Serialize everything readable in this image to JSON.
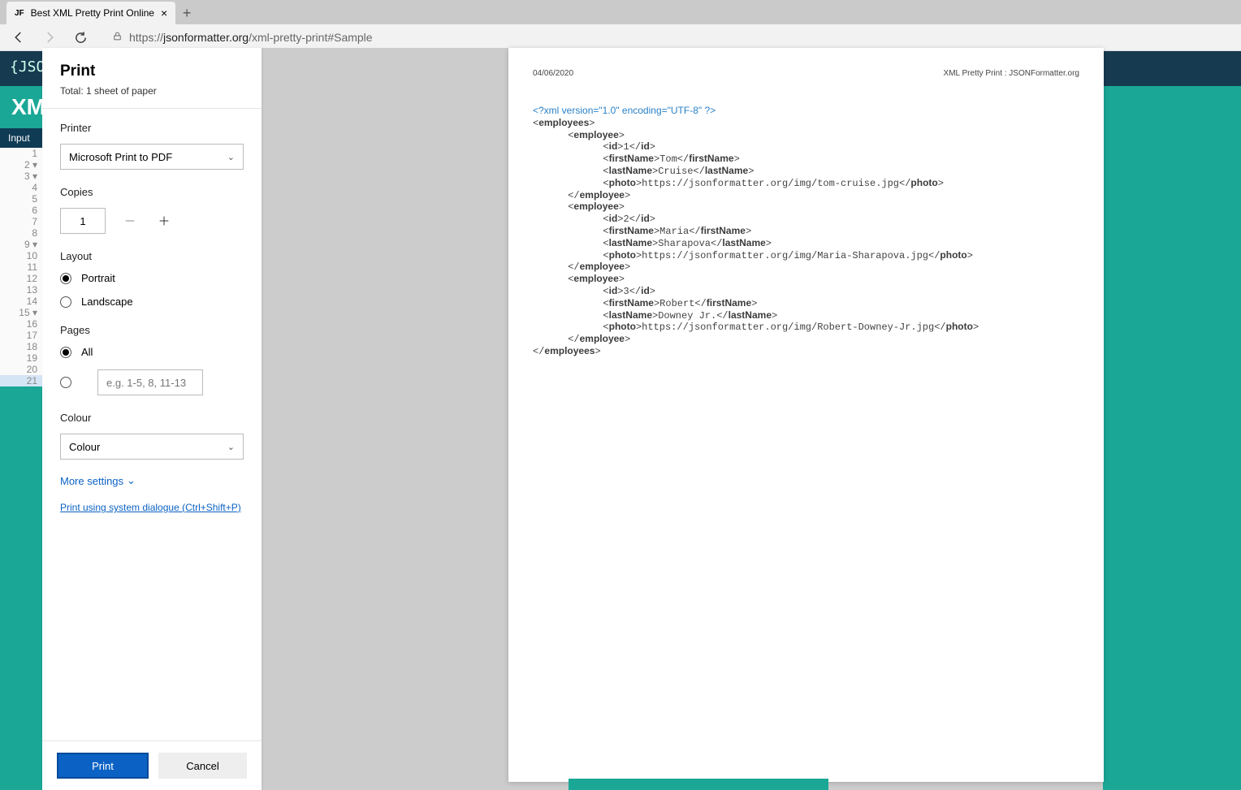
{
  "browser": {
    "tab_favicon": "JF",
    "tab_title": "Best XML Pretty Print Online",
    "url_plain": "https://",
    "url_host": "jsonformatter.org",
    "url_path": "/xml-pretty-print#Sample"
  },
  "bg": {
    "logo": "{JSO",
    "page_title": "XM",
    "toollabel": "Input",
    "folds": [
      "2",
      "3",
      "9",
      "15"
    ]
  },
  "print": {
    "title": "Print",
    "total": "Total: 1 sheet of paper",
    "printer_label": "Printer",
    "printer_value": "Microsoft Print to PDF",
    "copies_label": "Copies",
    "copies_value": "1",
    "layout_label": "Layout",
    "layout_portrait": "Portrait",
    "layout_landscape": "Landscape",
    "pages_label": "Pages",
    "pages_all": "All",
    "pages_range_placeholder": "e.g. 1-5, 8, 11-13",
    "colour_label": "Colour",
    "colour_value": "Colour",
    "more_settings": "More settings",
    "system_dialog": "Print using system dialogue (Ctrl+Shift+P)",
    "print_btn": "Print",
    "cancel_btn": "Cancel"
  },
  "preview": {
    "date": "04/06/2020",
    "heading": "XML Pretty Print : JSONFormatter.org",
    "employees": [
      {
        "id": "1",
        "firstName": "Tom",
        "lastName": "Cruise",
        "photo": "https://jsonformatter.org/img/tom-cruise.jpg"
      },
      {
        "id": "2",
        "firstName": "Maria",
        "lastName": "Sharapova",
        "photo": "https://jsonformatter.org/img/Maria-Sharapova.jpg"
      },
      {
        "id": "3",
        "firstName": "Robert",
        "lastName": "Downey Jr.",
        "photo": "https://jsonformatter.org/img/Robert-Downey-Jr.jpg"
      }
    ]
  }
}
